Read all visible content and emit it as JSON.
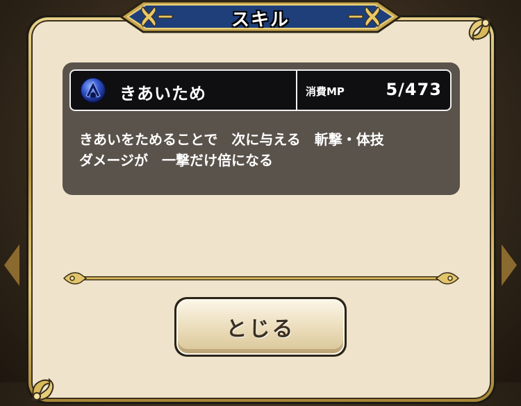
{
  "window": {
    "title": "スキル"
  },
  "skill": {
    "name": "きあいため",
    "mp_label": "消費MP",
    "mp_value": "5/473",
    "icon": "blue-skill-orb-icon",
    "description_lines": [
      "きあいをためることで　次に与える　斬撃・体技",
      "ダメージが　一撃だけ倍になる"
    ]
  },
  "buttons": {
    "close_label": "とじる"
  },
  "colors": {
    "panel": "#efe4cb",
    "gold": "#c9a64f",
    "title_blue": "#1f3f7a",
    "info_box": "#5a534b",
    "skill_row": "#0f0f12"
  }
}
